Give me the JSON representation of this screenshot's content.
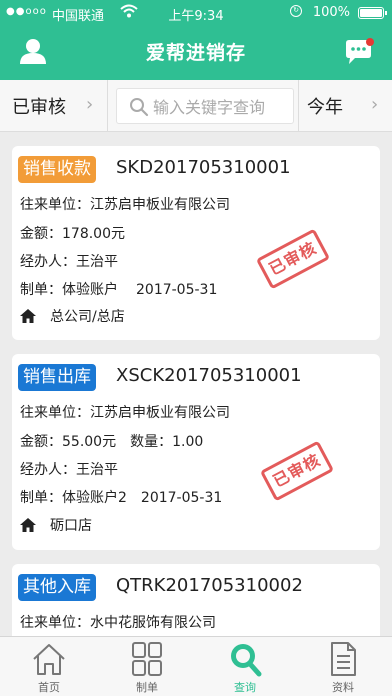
{
  "status_bar": {
    "signal": "●●ooo",
    "carrier": "中国联通",
    "time": "上午9:34",
    "battery": "100%"
  },
  "header": {
    "title": "爱帮进销存",
    "bg_color": "#2fbf93",
    "left_icon": "user-icon",
    "right_icon": "message-icon"
  },
  "filter": {
    "status_label": "已审核",
    "search_placeholder": "输入关键字查询",
    "period_label": "今年"
  },
  "cards": [
    {
      "type": "销售收款",
      "type_color": "#f29c38",
      "doc_no": "SKD201705310001",
      "partner_label": "往来单位：",
      "partner": "江苏启申板业有限公司",
      "amount_label": "金额：",
      "amount": "178.00元",
      "handler_label": "经办人：",
      "handler": "王治平",
      "maker_label": "制单：",
      "maker": "体验账户",
      "date": "2017-05-31",
      "store": "总公司/总店",
      "stamp": "已审核"
    },
    {
      "type": "销售出库",
      "type_color": "#1a78d4",
      "doc_no": "XSCK201705310001",
      "partner_label": "往来单位：",
      "partner": "江苏启申板业有限公司",
      "amount_label": "金额：",
      "amount": "55.00元",
      "qty_label": "数量：",
      "qty": "1.00",
      "handler_label": "经办人：",
      "handler": "王治平",
      "maker_label": "制单：",
      "maker": "体验账户2",
      "date": "2017-05-31",
      "store": "砺口店",
      "stamp": "已审核"
    },
    {
      "type": "其他入库",
      "type_color": "#1a78d4",
      "doc_no": "QTRK201705310002",
      "partner_label": "往来单位：",
      "partner": "水中花服饰有限公司"
    }
  ],
  "tabbar": [
    {
      "label": "首页",
      "icon": "home-icon"
    },
    {
      "label": "制单",
      "icon": "grid-icon"
    },
    {
      "label": "查询",
      "icon": "search-icon",
      "active": true
    },
    {
      "label": "资料",
      "icon": "document-icon"
    }
  ],
  "colors": {
    "accent": "#2fbf93",
    "stamp": "#e04a4a",
    "sales_receipt": "#f29c38",
    "stock_doc": "#1a78d4"
  }
}
